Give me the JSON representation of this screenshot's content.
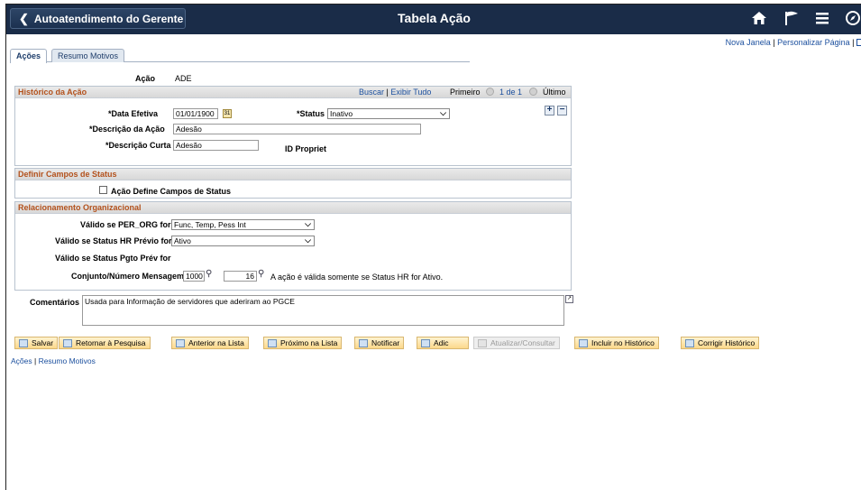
{
  "header": {
    "back_label": "Autoatendimento do Gerente",
    "title": "Tabela Ação"
  },
  "icons": [
    "home-icon",
    "flag-icon",
    "menu-icon",
    "compass-icon"
  ],
  "toplinks": {
    "new_window": "Nova Janela",
    "personalize": "Personalizar Página"
  },
  "tabs": {
    "acoes": "Ações",
    "motivos": "Resumo Motivos"
  },
  "acao": {
    "label": "Ação",
    "value": "ADE"
  },
  "historico": {
    "title": "Histórico da Ação",
    "buscar": "Buscar",
    "exibir": "Exibir Tudo",
    "primeiro": "Primeiro",
    "count": "1 de 1",
    "ultimo": "Último",
    "data_label": "*Data Efetiva",
    "data_value": "01/01/1900",
    "status_label": "*Status",
    "status_value": "Inativo",
    "desc_label": "*Descrição da Ação",
    "desc_value": "Adesão",
    "curta_label": "*Descrição Curta",
    "curta_value": "Adesão",
    "idprop_label": "ID Propriet"
  },
  "status_section": {
    "title": "Definir Campos de Status",
    "checkbox_label": "Ação Define Campos de Status"
  },
  "rel": {
    "title": "Relacionamento Organizacional",
    "per_org_label": "Válido se PER_ORG for",
    "per_org_value": "Func, Temp, Pess Int",
    "hr_label": "Válido se Status HR Prévio for",
    "hr_value": "Ativo",
    "pgto_label": "Válido se Status Pgto Prév for",
    "msg_label": "Conjunto/Número Mensagem",
    "msg_set": "1000",
    "msg_num": "16",
    "msg_text": "A ação é válida somente se Status HR for Ativo."
  },
  "comentarios": {
    "label": "Comentários",
    "value": "Usada para Informação de servidores que aderiram ao PGCE"
  },
  "buttons": {
    "salvar": "Salvar",
    "retornar": "Retornar à Pesquisa",
    "anterior": "Anterior na Lista",
    "proximo": "Próximo na Lista",
    "notificar": "Notificar",
    "adic": "Adic",
    "atualizar": "Atualizar/Consultar",
    "incluir": "Incluir no Histórico",
    "corrigir": "Corrigir Histórico"
  },
  "bottom_links": {
    "acoes": "Ações",
    "motivos": "Resumo Motivos"
  }
}
